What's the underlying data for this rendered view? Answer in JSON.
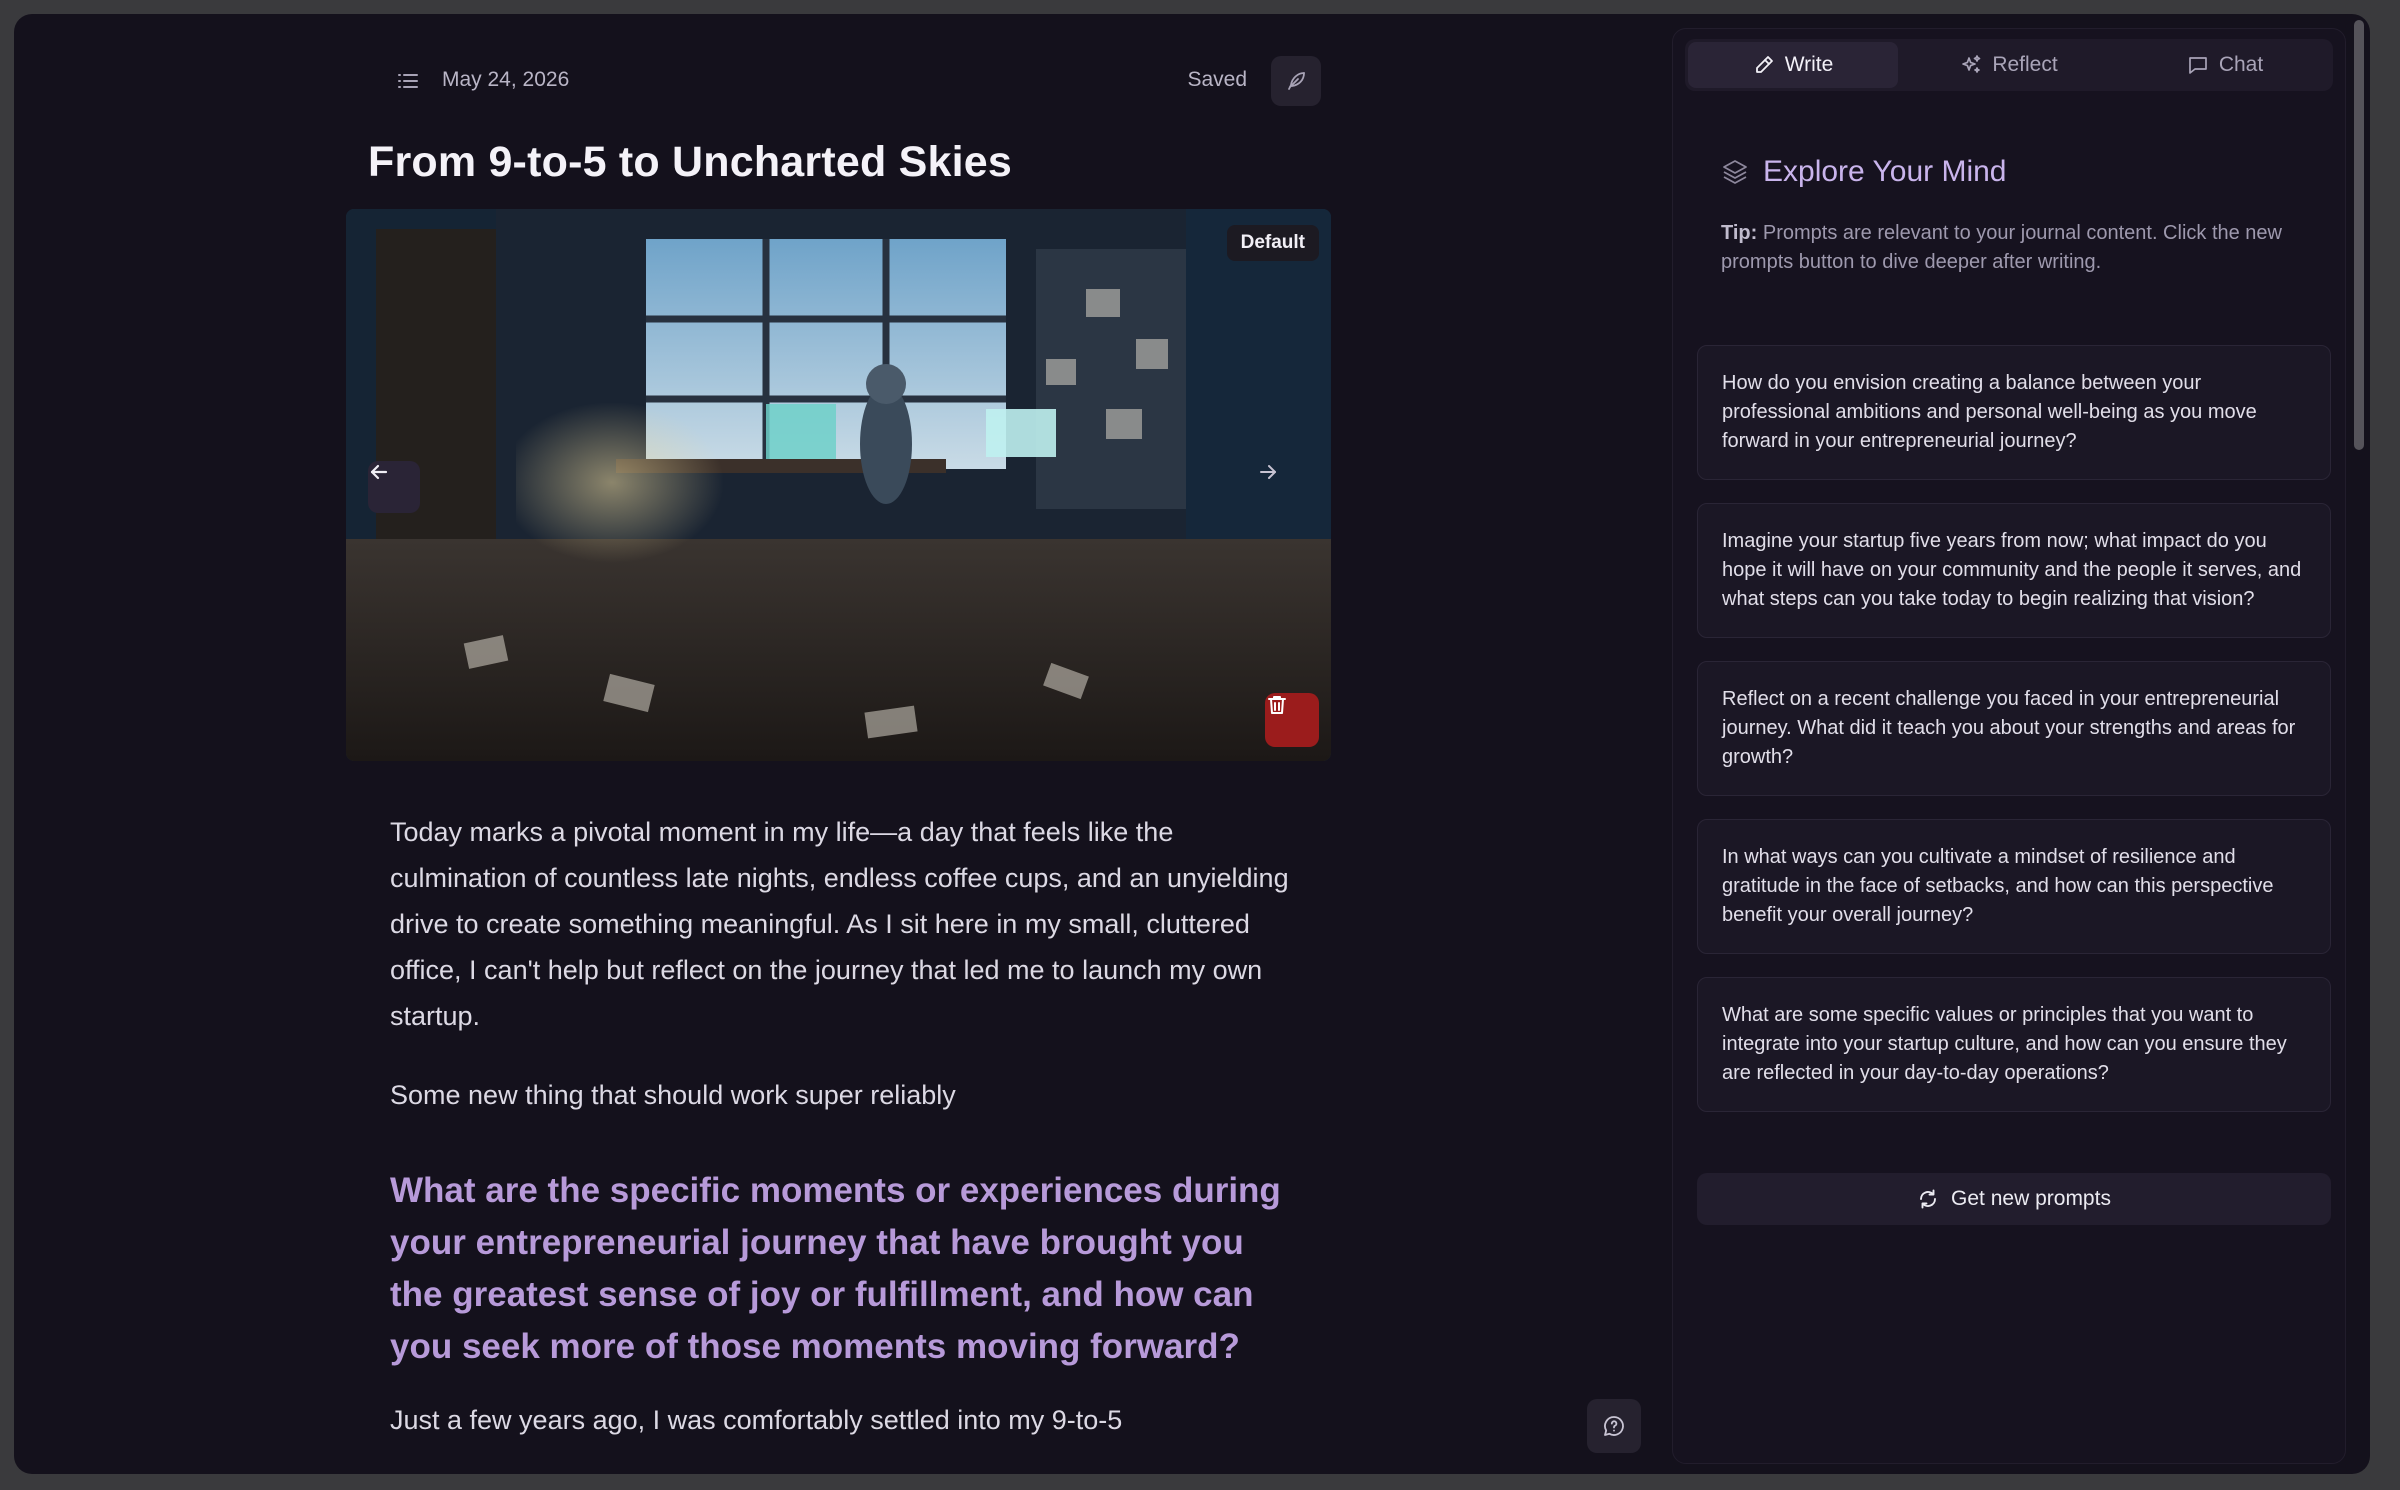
{
  "colors": {
    "background": "#14111c",
    "accent": "#b79ad9",
    "danger": "#9b1c1c",
    "panel": "#16121f"
  },
  "header": {
    "date": "May 24, 2026",
    "status": "Saved"
  },
  "entry": {
    "title": "From 9-to-5 to Uncharted Skies",
    "image_badge": "Default",
    "paragraphs": [
      "Today marks a pivotal moment in my life—a day that feels like the culmination of countless late nights, endless coffee cups, and an unyielding drive to create something meaningful. As I sit here in my small, cluttered office, I can't help but reflect on the journey that led me to launch my own startup.",
      "Some new thing that should work super reliably"
    ],
    "highlight_prompt": "What are the specific moments or experiences during your entrepreneurial journey that have brought you the greatest sense of joy or fulfillment, and how can you seek more of those moments moving forward?",
    "trailing_text": "Just a few years ago, I was comfortably settled into my 9-to-5"
  },
  "panel": {
    "tabs": [
      {
        "label": "Write",
        "icon": "pencil-icon",
        "active": true
      },
      {
        "label": "Reflect",
        "icon": "sparkles-icon",
        "active": false
      },
      {
        "label": "Chat",
        "icon": "chat-bubble-icon",
        "active": false
      }
    ],
    "section_title": "Explore Your Mind",
    "tip_label": "Tip:",
    "tip_text": " Prompts are relevant to your journal content. Click the new prompts button to dive deeper after writing.",
    "prompts": [
      "How do you envision creating a balance between your professional ambitions and personal well-being as you move forward in your entrepreneurial journey?",
      "Imagine your startup five years from now; what impact do you hope it will have on your community and the people it serves, and what steps can you take today to begin realizing that vision?",
      "Reflect on a recent challenge you faced in your entrepreneurial journey. What did it teach you about your strengths and areas for growth?",
      "In what ways can you cultivate a mindset of resilience and gratitude in the face of setbacks, and how can this perspective benefit your overall journey?",
      "What are some specific values or principles that you want to integrate into your startup culture, and how can you ensure they are reflected in your day-to-day operations?"
    ],
    "new_prompts_label": "Get new prompts"
  }
}
